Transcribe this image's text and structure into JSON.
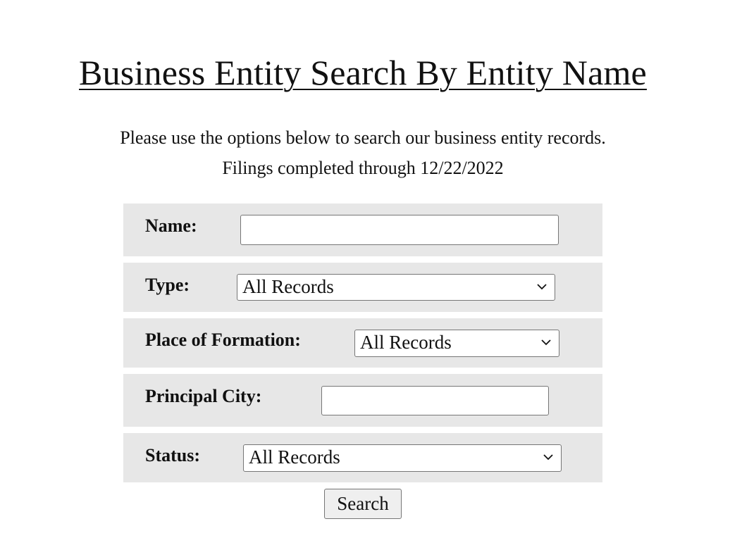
{
  "page": {
    "title": "Business Entity Search By Entity Name",
    "intro_line1": "Please use the options below to search our business entity records.",
    "intro_line2": "Filings completed through 12/22/2022"
  },
  "form": {
    "name": {
      "label": "Name:",
      "value": "",
      "placeholder": ""
    },
    "type": {
      "label": "Type:",
      "selected": "All Records"
    },
    "place_of_formation": {
      "label": "Place of Formation:",
      "selected": "All Records"
    },
    "principal_city": {
      "label": "Principal City:",
      "value": "",
      "placeholder": ""
    },
    "status": {
      "label": "Status:",
      "selected": "All Records"
    },
    "search_button": "Search"
  },
  "colors": {
    "row_background": "#e7e7e7",
    "button_background": "#efefef"
  }
}
